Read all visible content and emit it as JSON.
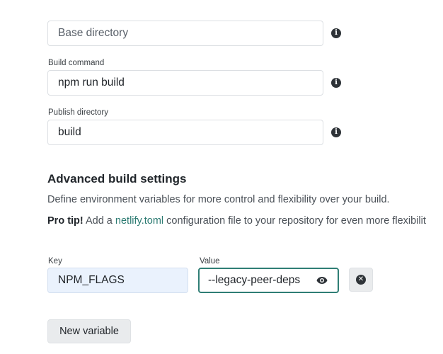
{
  "build_settings": {
    "base_directory": {
      "placeholder": "Base directory",
      "info_icon": "info-icon"
    },
    "build_command": {
      "label": "Build command",
      "value": "npm run build",
      "info_icon": "info-icon"
    },
    "publish_directory": {
      "label": "Publish directory",
      "value": "build",
      "info_icon": "info-icon"
    }
  },
  "advanced": {
    "title": "Advanced build settings",
    "description": "Define environment variables for more control and flexibility over your build.",
    "pro_tip_strong": "Pro tip!",
    "pro_tip_pre": " Add a ",
    "pro_tip_link": "netlify.toml",
    "pro_tip_post": " configuration file to your repository for even more flexibilit"
  },
  "env_var": {
    "key_label": "Key",
    "key_value": "NPM_FLAGS",
    "value_label": "Value",
    "value_value": "--legacy-peer-deps",
    "reveal_icon": "eye-icon",
    "delete_icon": "close-circle-icon"
  },
  "actions": {
    "new_variable_label": "New variable"
  },
  "colors": {
    "accent": "#2f7e75",
    "link": "#2b7a71",
    "key_field_bg": "#eaf2fd",
    "button_bg": "#e9ebed"
  }
}
